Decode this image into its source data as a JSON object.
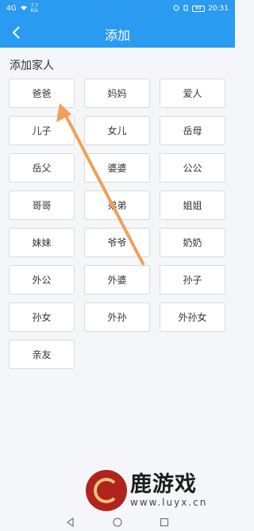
{
  "status_bar": {
    "signal": "4G",
    "speed_top": "7.7",
    "speed_bottom": "K/s",
    "battery": "69",
    "time": "20:31"
  },
  "app_bar": {
    "title": "添加",
    "back_icon": "chevron-left-icon"
  },
  "section": {
    "title": "添加家人"
  },
  "members": [
    {
      "label": "爸爸"
    },
    {
      "label": "妈妈"
    },
    {
      "label": "爱人"
    },
    {
      "label": "儿子"
    },
    {
      "label": "女儿"
    },
    {
      "label": "岳母"
    },
    {
      "label": "岳父"
    },
    {
      "label": "婆婆"
    },
    {
      "label": "公公"
    },
    {
      "label": "哥哥"
    },
    {
      "label": "弟弟"
    },
    {
      "label": "姐姐"
    },
    {
      "label": "妹妹"
    },
    {
      "label": "爷爷"
    },
    {
      "label": "奶奶"
    },
    {
      "label": "外公"
    },
    {
      "label": "外婆"
    },
    {
      "label": "孙子"
    },
    {
      "label": "孙女"
    },
    {
      "label": "外孙"
    },
    {
      "label": "外孙女"
    },
    {
      "label": "亲友"
    }
  ],
  "watermark": {
    "brand": "鹿游戏",
    "url": "www.luyx.cn"
  },
  "colors": {
    "accent": "#2b9bf2",
    "annotation_arrow": "#f0a05a"
  },
  "nav_bar": {
    "back_icon": "triangle-back-icon",
    "home_icon": "circle-home-icon",
    "recents_icon": "square-recents-icon"
  }
}
